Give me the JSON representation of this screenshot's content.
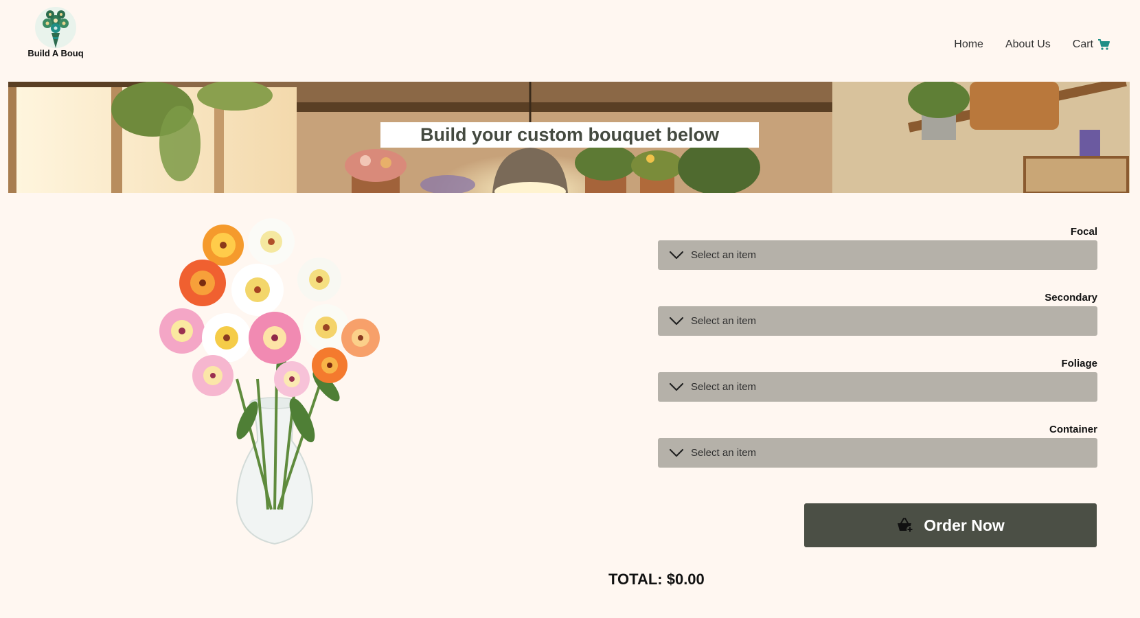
{
  "brand": {
    "name": "Build A Bouq",
    "logo_icon": "bouquet-logo-icon"
  },
  "nav": {
    "items": [
      {
        "label": "Home"
      },
      {
        "label": "About Us"
      },
      {
        "label": "Cart",
        "icon": "cart-icon"
      }
    ]
  },
  "banner": {
    "title": "Build your custom bouquet below"
  },
  "selectors": [
    {
      "label": "Focal",
      "value": "Select an item"
    },
    {
      "label": "Secondary",
      "value": "Select an item"
    },
    {
      "label": "Foliage",
      "value": "Select an item"
    },
    {
      "label": "Container",
      "value": "Select an item"
    }
  ],
  "order": {
    "label": "Order Now",
    "icon": "basket-plus-icon"
  },
  "total": {
    "text": "TOTAL: $0.00"
  },
  "colors": {
    "background": "#fff7f1",
    "select_bg": "#b5b1a9",
    "button_bg": "#4b4f45",
    "accent_cart": "#1f8f86"
  }
}
